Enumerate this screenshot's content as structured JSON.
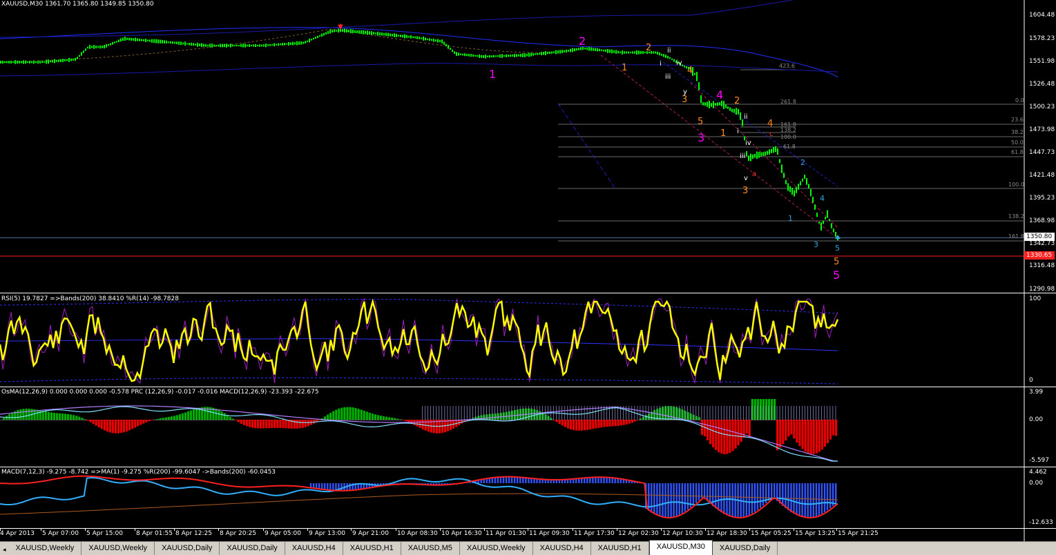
{
  "main": {
    "title": "XAUUSD,M30",
    "ohlc": "1361.70 1365.80 1349.85 1350.80",
    "price_axis": [
      "1604.48",
      "1578.23",
      "1551.98",
      "1526.48",
      "1500.23",
      "1473.98",
      "1447.73",
      "1421.48",
      "1395.23",
      "1368.98",
      "1342.73",
      "1316.48",
      "1290.98"
    ],
    "current_price": "1350.80",
    "line_price": "1330.65",
    "fib_labels": [
      {
        "text": "423.6"
      },
      {
        "text": "261.8"
      },
      {
        "text": "161.8"
      },
      {
        "text": "138.2"
      },
      {
        "text": "100.0"
      },
      {
        "text": "61.8"
      },
      {
        "text": "0.0"
      },
      {
        "text": "23.6"
      },
      {
        "text": "38.2"
      },
      {
        "text": "50.0"
      },
      {
        "text": "61.8"
      },
      {
        "text": "100.0"
      },
      {
        "text": "138.2"
      },
      {
        "text": "161.8"
      }
    ],
    "wave_labels": [
      {
        "text": "1",
        "style": "big"
      },
      {
        "text": "2",
        "style": "big"
      },
      {
        "text": "3",
        "style": "big"
      },
      {
        "text": "4",
        "style": "big"
      },
      {
        "text": "5",
        "style": "big"
      },
      {
        "text": "1",
        "style": "or"
      },
      {
        "text": "2",
        "style": "or"
      },
      {
        "text": "3",
        "style": "or"
      },
      {
        "text": "4",
        "style": "or"
      },
      {
        "text": "5",
        "style": "or"
      },
      {
        "text": "1",
        "style": "or"
      },
      {
        "text": "2",
        "style": "or"
      },
      {
        "text": "3",
        "style": "or"
      },
      {
        "text": "4",
        "style": "or"
      },
      {
        "text": "5",
        "style": "or"
      },
      {
        "text": "ii",
        "style": "wh"
      },
      {
        "text": "i",
        "style": "wh"
      },
      {
        "text": "iii",
        "style": "wh"
      },
      {
        "text": "iv",
        "style": "wh"
      },
      {
        "text": "y",
        "style": "wh"
      },
      {
        "text": "ii",
        "style": "wh"
      },
      {
        "text": "i",
        "style": "wh"
      },
      {
        "text": "iv",
        "style": "wh"
      },
      {
        "text": "iii",
        "style": "wh"
      },
      {
        "text": "v",
        "style": "wh"
      },
      {
        "text": "c",
        "style": "rd"
      },
      {
        "text": "a",
        "style": "rd"
      },
      {
        "text": "1",
        "style": "bl"
      },
      {
        "text": "2",
        "style": "bl"
      },
      {
        "text": "3",
        "style": "bl"
      },
      {
        "text": "4",
        "style": "bl"
      },
      {
        "text": "5",
        "style": "bl"
      }
    ]
  },
  "rsi": {
    "label": "RSI(5) 19.7827  =>Bands(200) 38.8410  %R(14) -98.7828",
    "axis": [
      "100",
      "0"
    ]
  },
  "osma": {
    "label": "OsMA(12,26,9) 0.000 0.000 0.000 -0.578  PRC (12,26,9) -0.017 -0.016  MACD(12,26,9) -23.393 -22.675",
    "axis": [
      "3.99",
      "0.00",
      "-5.597"
    ]
  },
  "macd": {
    "label": "MACD(7,12,3) -9.275 -8.742  =>MA(1) -9.275  %R(200) -99.6047  ->Bands(200) -60.0453",
    "axis": [
      "4.462",
      "0.00",
      "-12.633"
    ]
  },
  "time_axis": [
    "4 Apr 2013",
    "5 Apr 07:00",
    "5 Apr 15:00",
    "8 Apr 01:55",
    "8 Apr 12:25",
    "8 Apr 20:25",
    "9 Apr 05:00",
    "9 Apr 13:00",
    "9 Apr 21:00",
    "10 Apr 08:30",
    "10 Apr 16:30",
    "11 Apr 01:30",
    "11 Apr 09:30",
    "11 Apr 17:30",
    "12 Apr 02:30",
    "12 Apr 10:30",
    "12 Apr 18:30",
    "15 Apr 05:25",
    "15 Apr 13:25",
    "15 Apr 21:25"
  ],
  "tabs": [
    "XAUUSD,Weekly",
    "XAUUSD,Weekly",
    "XAUUSD,Daily",
    "XAUUSD,Daily",
    "XAUUSD,H4",
    "XAUUSD,H1",
    "XAUUSD,M5",
    "XAUUSD,Weekly",
    "XAUUSD,H4",
    "XAUUSD,H1",
    "XAUUSD,M30",
    "XAUUSD,Daily"
  ],
  "active_tab": "XAUUSD,M30",
  "colors": {
    "candle_up": "#00ff00",
    "candle_dn": "#00ff00",
    "band": "#2020ff",
    "rsi": "#ffff00",
    "hist_up": "#00c000",
    "hist_dn": "#ff0000",
    "macd_hist": "#3355ff"
  }
}
